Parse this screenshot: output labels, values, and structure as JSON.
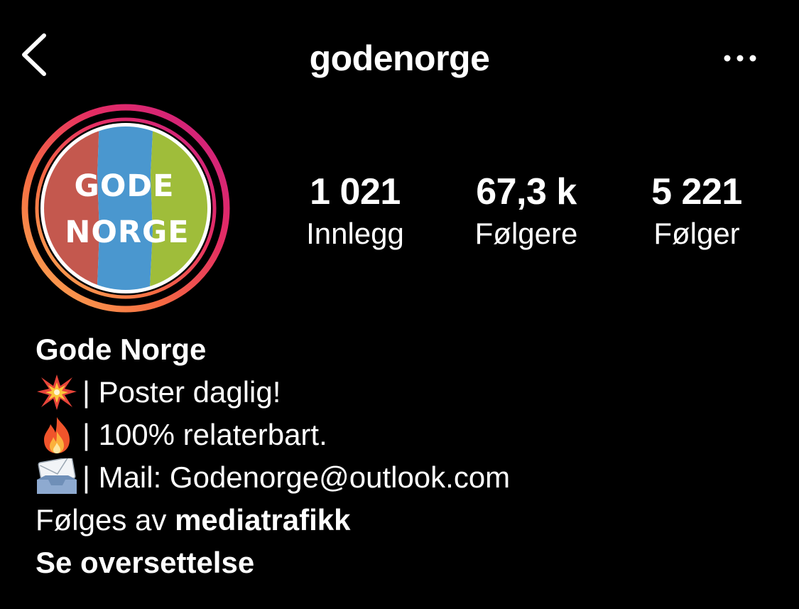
{
  "header": {
    "username": "godenorge",
    "back_icon": "chevron-left-icon",
    "more_icon": "more-horizontal-icon"
  },
  "avatar": {
    "line1": "GODE",
    "line2": "NORGE",
    "stripe_colors": [
      "#c4584e",
      "#4a97cf",
      "#9fbd3a"
    ]
  },
  "stats": {
    "posts": {
      "value": "1 021",
      "label": "Innlegg"
    },
    "followers": {
      "value": "67,3 k",
      "label": "Følgere"
    },
    "following": {
      "value": "5 221",
      "label": "Følger"
    }
  },
  "bio": {
    "name": "Gode Norge",
    "line1": "| Poster daglig!",
    "line2": "| 100% relaterbart.",
    "line3": "| Mail: Godenorge@outlook.com",
    "line1_icon": "collision-emoji-icon",
    "line2_icon": "fire-emoji-icon",
    "line3_icon": "envelope-tray-emoji-icon",
    "followed_by_prefix": "Følges av ",
    "followed_by_user": "mediatrafikk",
    "translate_link": "Se oversettelse"
  }
}
